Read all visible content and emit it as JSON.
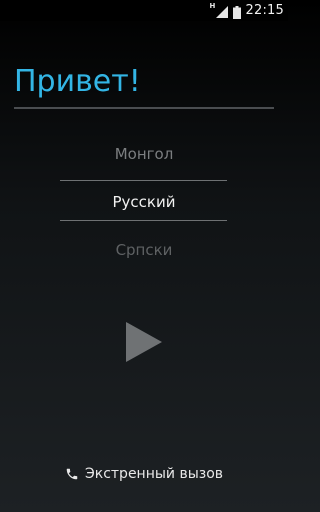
{
  "status_bar": {
    "network_label": "H",
    "time": "22:15",
    "icons": [
      "signal-icon",
      "battery-icon"
    ]
  },
  "welcome": {
    "title": "Привет!"
  },
  "language_picker": {
    "items": [
      "Монгол",
      "Русский",
      "Српски"
    ],
    "selected": "Русский"
  },
  "start": {
    "icon": "play-icon"
  },
  "emergency": {
    "icon": "phone-icon",
    "label": "Экстренный вызов"
  },
  "colors": {
    "accent": "#33b5e5",
    "text_primary": "#f2f2f2",
    "text_dim": "#7b7e80"
  }
}
